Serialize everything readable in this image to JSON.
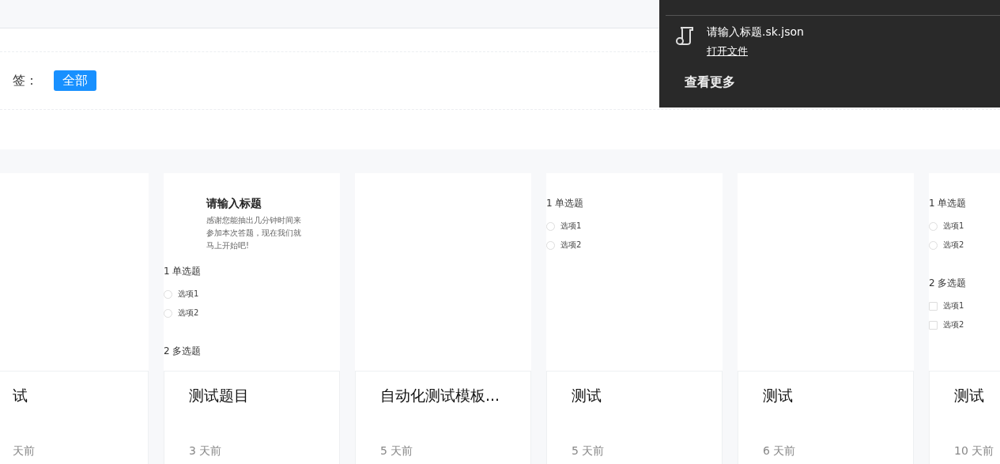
{
  "tag_filter": {
    "label": "签：",
    "tags": [
      {
        "label": "全部",
        "selected": true
      }
    ]
  },
  "cards": [
    {
      "title": "试",
      "age": "天前"
    },
    {
      "title": "测试题目",
      "age": "3 天前",
      "preview": {
        "header": {
          "title": "请输入标题",
          "description": "感谢您能抽出几分钟时间来参加本次答题，现在我们就马上开始吧!"
        },
        "questions": [
          {
            "number": "1",
            "title": "单选题",
            "kind": "single",
            "options": [
              "选项1",
              "选项2"
            ]
          },
          {
            "number": "2",
            "title": "多选题",
            "kind": "multi"
          }
        ]
      }
    },
    {
      "title": "自动化测试模板...",
      "age": "5 天前"
    },
    {
      "title": "测试",
      "age": "5 天前",
      "preview": {
        "questions": [
          {
            "number": "1",
            "title": "单选题",
            "kind": "single",
            "options": [
              "选项1",
              "选项2"
            ]
          }
        ]
      }
    },
    {
      "title": "测试",
      "age": "6 天前"
    },
    {
      "title": "测试",
      "age": "10 天前",
      "preview": {
        "questions": [
          {
            "number": "1",
            "title": "单选题",
            "kind": "single",
            "options": [
              "选项1",
              "选项2"
            ]
          },
          {
            "number": "2",
            "title": "多选题",
            "kind": "multi",
            "options": [
              "选项1",
              "选项2"
            ]
          }
        ]
      }
    }
  ],
  "download_panel": {
    "file_name": "请输入标题.sk.json",
    "open_link": "打开文件",
    "more": "查看更多"
  }
}
